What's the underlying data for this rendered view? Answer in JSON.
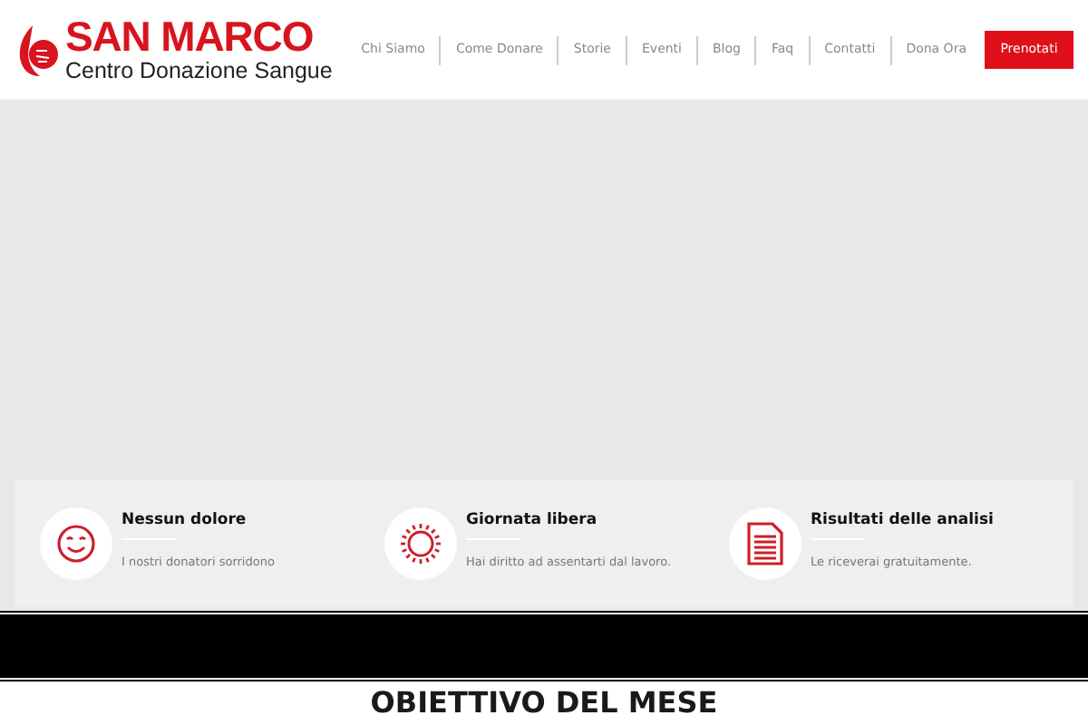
{
  "logo": {
    "name": "SAN MARCO",
    "tagline": "Centro Donazione Sangue"
  },
  "nav": {
    "items": [
      "Chi Siamo",
      "Come Donare",
      "Storie",
      "Eventi",
      "Blog",
      "Faq",
      "Contatti",
      "Dona Ora"
    ],
    "cta": "Prenotati"
  },
  "features": [
    {
      "kind": "smile",
      "title": "Nessun dolore",
      "text": "I nostri donatori sorridono"
    },
    {
      "kind": "sun",
      "title": "Giornata libera",
      "text": "Hai diritto ad assentarti dal lavoro."
    },
    {
      "kind": "document",
      "title": "Risultati delle analisi",
      "text": "Le riceverai gratuitamente."
    }
  ],
  "section_title": "OBIETTIVO DEL MESE"
}
